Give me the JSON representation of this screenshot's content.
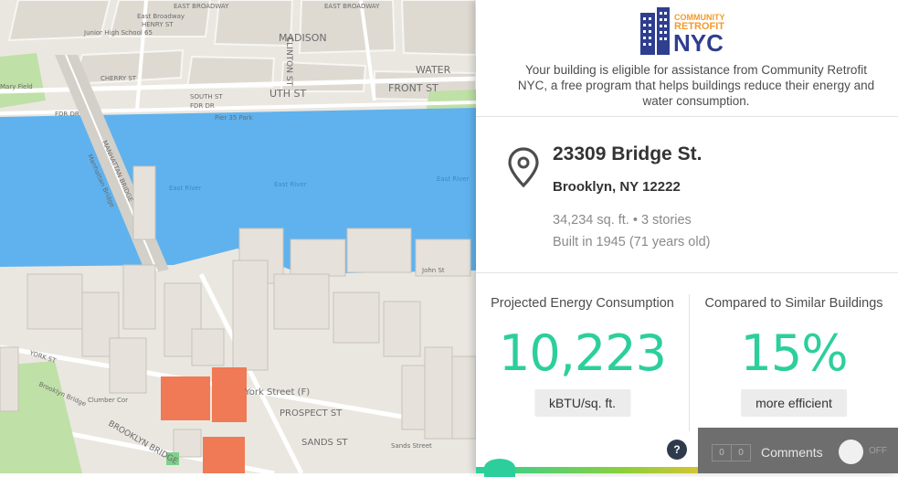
{
  "map": {
    "street_labels": [
      "EAST BROADWAY",
      "EAST BROADWAY",
      "East Broadway",
      "HENRY ST",
      "Junior High School 65",
      "MADISON",
      "CLINTON ST",
      "CHERRY ST",
      "WATER",
      "SOUTH ST",
      "FRONT ST",
      "UTH ST",
      "FDR DR",
      "FDR DR",
      "Pier 35 Park",
      "East River",
      "East River",
      "East River",
      "MANHATTAN BRIDGE",
      "Manhattan Bridge",
      "John St",
      "YORK ST",
      "Brooklyn Bridge",
      "Clumber Cor",
      "York Street (F)",
      "PROSPECT ST",
      "SANDS ST",
      "Sands Street",
      "BROOKLYN BRIDGE",
      "Mary Field"
    ]
  },
  "logo": {
    "line1": "COMMUNITY",
    "line2": "RETROFIT",
    "line3": "NYC"
  },
  "intro_text": "Your building is eligible for assistance from Community Retrofit NYC, a free program that helps buildings reduce their energy and water consumption.",
  "building": {
    "address_line1": "23309 Bridge St.",
    "address_line2": "Brooklyn, NY 12222",
    "size_stories": "34,234 sq. ft. • 3 stories",
    "built": "Built in 1945 (71 years old)"
  },
  "stats": {
    "energy_label": "Projected Energy Consumption",
    "energy_value": "10,223",
    "energy_unit": "kBTU/sq. ft.",
    "compare_label": "Compared to Similar Buildings",
    "compare_value": "15%",
    "compare_unit": "more efficient"
  },
  "help_label": "?",
  "comments": {
    "count_a": "0",
    "count_b": "0",
    "label": "Comments",
    "toggle_state": "OFF"
  },
  "colors": {
    "accent_green": "#2ccf9b",
    "water": "#5fb2ee",
    "highlight_building": "#f07a55",
    "logo_navy": "#2f3e8f",
    "logo_orange": "#f39a2b"
  }
}
